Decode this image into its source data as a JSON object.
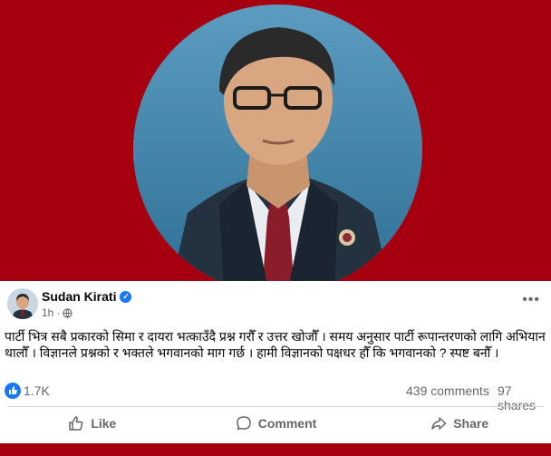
{
  "colors": {
    "banner": "#a60010",
    "text": "#050505",
    "secondary": "#65676b",
    "accent": "#1877f2"
  },
  "post": {
    "author": "Sudan Kirati",
    "time": "1h",
    "separator": "·",
    "text": "पार्टी भित्र सबै प्रकारको सिमा र दायरा भत्काउँदै प्रश्न गरौँ र उत्तर खोजौँ । समय अनुसार पार्टी रूपान्तरणको लागि अभियान थालौँ । विज्ञानले प्रश्नको र भक्तले भगवानको माग गर्छ । हामी विज्ञानको पक्षधर हौँ कि भगवानको ?  स्पष्ट बनौँ ।",
    "more": "•••"
  },
  "stats": {
    "likes": "1.7K",
    "comments": "439 comments",
    "shares": "97 shares"
  },
  "actions": {
    "like": "Like",
    "comment": "Comment",
    "share": "Share"
  },
  "icons": {
    "verified": "verified-check-icon",
    "audience": "globe-icon",
    "more": "more-options-icon",
    "like_badge": "thumbs-up-icon",
    "like_action": "thumbs-up-outline-icon",
    "comment_action": "speech-bubble-icon",
    "share_action": "share-arrow-icon"
  }
}
